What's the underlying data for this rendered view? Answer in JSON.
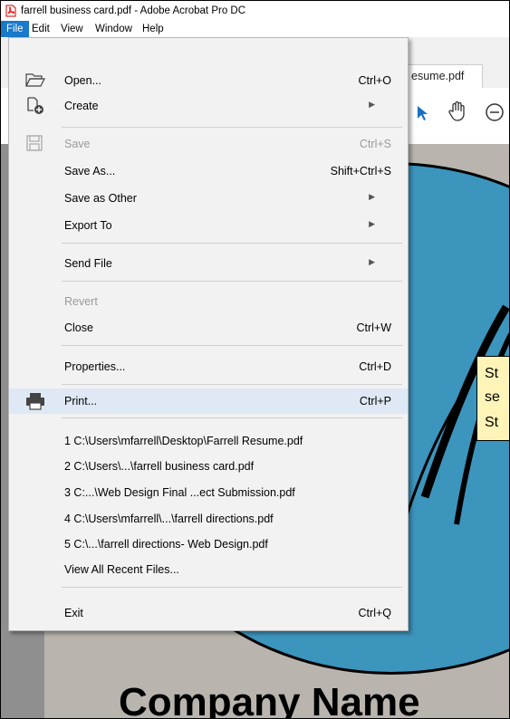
{
  "window": {
    "title": "farrell business card.pdf - Adobe Acrobat Pro DC"
  },
  "menubar": {
    "items": [
      "File",
      "Edit",
      "View",
      "Window",
      "Help"
    ]
  },
  "tabs": [
    {
      "label": "esume.pdf"
    }
  ],
  "file_menu": {
    "open": {
      "label": "Open...",
      "shortcut": "Ctrl+O"
    },
    "create": {
      "label": "Create"
    },
    "save": {
      "label": "Save",
      "shortcut": "Ctrl+S"
    },
    "save_as": {
      "label": "Save As...",
      "shortcut": "Shift+Ctrl+S"
    },
    "save_as_other": {
      "label": "Save as Other"
    },
    "export_to": {
      "label": "Export To"
    },
    "send_file": {
      "label": "Send File"
    },
    "revert": {
      "label": "Revert"
    },
    "close": {
      "label": "Close",
      "shortcut": "Ctrl+W"
    },
    "properties": {
      "label": "Properties...",
      "shortcut": "Ctrl+D"
    },
    "print": {
      "label": "Print...",
      "shortcut": "Ctrl+P"
    },
    "recent": [
      "1 C:\\Users\\mfarrell\\Desktop\\Farrell Resume.pdf",
      "2 C:\\Users\\...\\farrell business card.pdf",
      "3 C:...\\Web Design Final ...ect Submission.pdf",
      "4 C:\\Users\\mfarrell\\...\\farrell directions.pdf",
      "5 C:\\...\\farrell directions- Web Design.pdf"
    ],
    "view_all_recent": {
      "label": "View All Recent Files..."
    },
    "exit": {
      "label": "Exit",
      "shortcut": "Ctrl+Q"
    }
  },
  "document": {
    "company_text": "Company Name",
    "note_lines": [
      "St",
      "se",
      "St"
    ]
  },
  "colors": {
    "menu_highlight": "#1979ca",
    "circle_fill": "#3c95bd",
    "note_bg": "#fff4b8"
  }
}
